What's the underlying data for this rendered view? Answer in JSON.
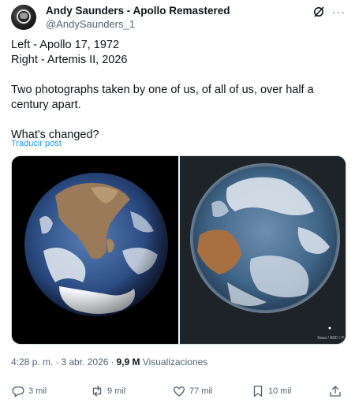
{
  "author": {
    "name": "Andy Saunders - Apollo Remastered",
    "handle": "@AndySaunders_1"
  },
  "post": {
    "lines": [
      "Left - Apollo 17, 1972",
      "Right - Artemis II, 2026",
      "",
      "Two photographs taken by one of us, of all of us, over half a century apart.",
      "",
      "What's changed?"
    ],
    "translate_label": "Traducir post"
  },
  "media": {
    "credit": "Nasa / ARD / P"
  },
  "meta": {
    "time": "4:28 p. m.",
    "date": "3 abr. 2026",
    "views_count": "9,9 M",
    "views_label": "Visualizaciones"
  },
  "actions": {
    "replies": "3 mil",
    "reposts": "9 mil",
    "likes": "77 mil",
    "bookmarks": "10 mil"
  },
  "colors": {
    "link": "#1d9bf0",
    "secondary_text": "#536471",
    "primary_text": "#0f1419"
  }
}
